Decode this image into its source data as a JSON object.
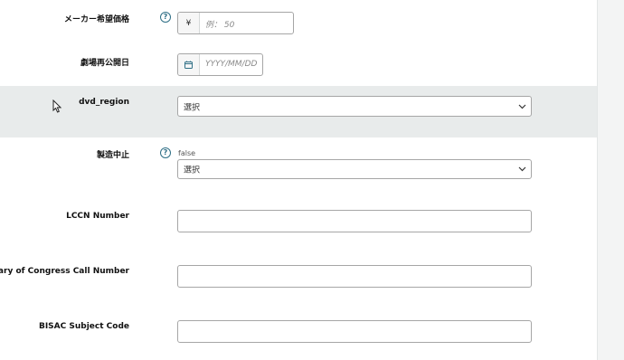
{
  "form": {
    "list_price": {
      "label": "メーカー希望価格",
      "currency_symbol": "¥",
      "placeholder": "例： 50"
    },
    "theatrical_release_date": {
      "label": "劇場再公開日",
      "placeholder": "YYYY/MM/DD"
    },
    "dvd_region": {
      "label": "dvd_region",
      "selected": "選択"
    },
    "discontinued": {
      "label": "製造中止",
      "current_value": "false",
      "selected": "選択"
    },
    "lccn_number": {
      "label": "LCCN Number",
      "value": ""
    },
    "loc_call_number": {
      "label": "Library of Congress Call Number",
      "value": ""
    },
    "bisac_subject_code": {
      "label": "BISAC Subject Code",
      "value": ""
    }
  },
  "colors": {
    "help_icon": "#2f6f86",
    "highlight_row": "#e8ebeb",
    "input_border": "#a6a6a6"
  },
  "icons": {
    "help": "question-circle",
    "calendar": "calendar",
    "dropdown": "chevron-down"
  }
}
